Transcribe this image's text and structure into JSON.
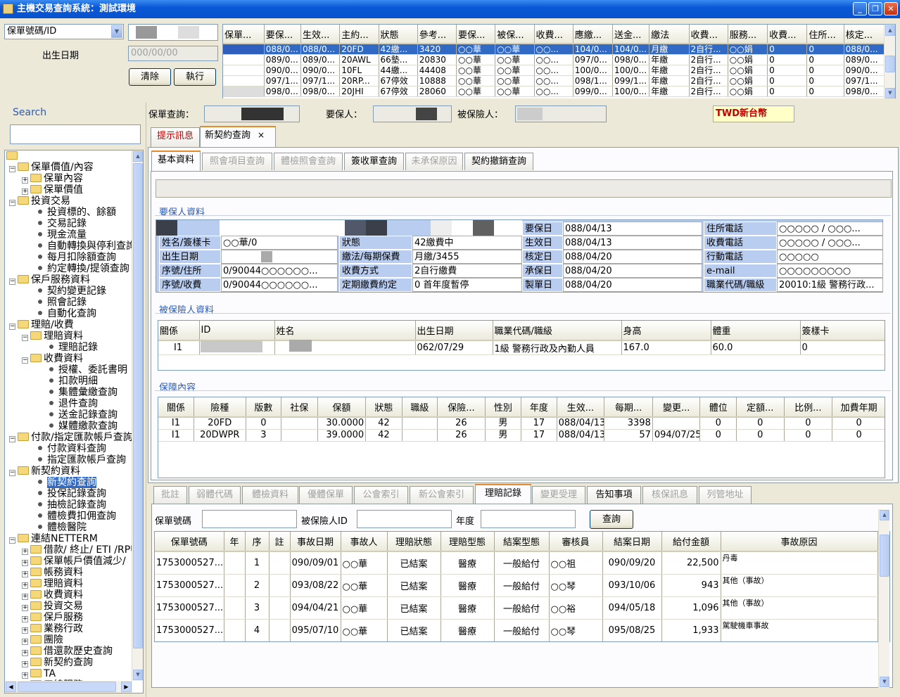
{
  "window": {
    "title": "主機交易查詢系統：測試環境",
    "btn_min": "_",
    "btn_max": "❐",
    "btn_close": "✕"
  },
  "search": {
    "field_select": "保單號碼/ID",
    "birth_label": "出生日期",
    "birth_placeholder": "000/00/00",
    "clear": "清除",
    "execute": "執行"
  },
  "topgrid": {
    "headers": [
      "保單...",
      "要保...",
      "生效...",
      "主約...",
      "狀態",
      "參考...",
      "要保...",
      "被保...",
      "收費...",
      "應繳...",
      "送金...",
      "繳法",
      "收費...",
      "服務...",
      "收費...",
      "住所...",
      "核定..."
    ],
    "rows": [
      [
        "",
        "088/0...",
        "088/0...",
        "20FD",
        "42繳...",
        "3420",
        "○○華",
        "○○華",
        "○○...",
        "104/0...",
        "104/0...",
        "月繳",
        "2自行...",
        "○○娟",
        "0",
        "0",
        "088/0..."
      ],
      [
        "",
        "089/0...",
        "089/0...",
        "20AWL",
        "66墊...",
        "20830",
        "○○華",
        "○○華",
        "○○...",
        "097/0...",
        "098/0...",
        "年繳",
        "2自行...",
        "○○娟",
        "0",
        "0",
        "089/0..."
      ],
      [
        "",
        "090/0...",
        "090/0...",
        "10FL",
        "44繳...",
        "44408",
        "○○華",
        "○○華",
        "○○...",
        "100/0...",
        "100/0...",
        "年繳",
        "2自行...",
        "○○娟",
        "0",
        "0",
        "090/0..."
      ],
      [
        "",
        "097/1...",
        "097/1...",
        "20RP...",
        "67停效",
        "10888",
        "○○華",
        "○○華",
        "○○...",
        "098/1...",
        "099/1...",
        "年繳",
        "2自行...",
        "○○娟",
        "0",
        "0",
        "097/1..."
      ],
      [
        "",
        "098/0...",
        "098/0...",
        "20JHI",
        "67停效",
        "28060",
        "○○華",
        "○○華",
        "○○...",
        "099/0...",
        "100/0...",
        "年繳",
        "2自行...",
        "○○娟",
        "0",
        "0",
        "098/0..."
      ]
    ]
  },
  "nav": {
    "search_label": "Search",
    "tree": [
      {
        "level": 1,
        "kind": "folder",
        "label": "保單價值/內容",
        "pm": "-"
      },
      {
        "level": 2,
        "kind": "folder",
        "label": "保單內容",
        "pm": "+"
      },
      {
        "level": 2,
        "kind": "folder",
        "label": "保單價值",
        "pm": "+"
      },
      {
        "level": 1,
        "kind": "folder",
        "label": "投資交易",
        "pm": "-"
      },
      {
        "level": 3,
        "kind": "leaf",
        "label": "投資標的、餘額"
      },
      {
        "level": 3,
        "kind": "leaf",
        "label": "交易記錄"
      },
      {
        "level": 3,
        "kind": "leaf",
        "label": "現金流量"
      },
      {
        "level": 3,
        "kind": "leaf",
        "label": "自動轉換與停利查詢"
      },
      {
        "level": 3,
        "kind": "leaf",
        "label": "每月扣除額查詢"
      },
      {
        "level": 3,
        "kind": "leaf",
        "label": "約定轉換/提領查詢"
      },
      {
        "level": 1,
        "kind": "folder",
        "label": "保戶服務資料",
        "pm": "-"
      },
      {
        "level": 3,
        "kind": "leaf",
        "label": "契約變更記錄"
      },
      {
        "level": 3,
        "kind": "leaf",
        "label": "照會記錄"
      },
      {
        "level": 3,
        "kind": "leaf",
        "label": "自動化查詢"
      },
      {
        "level": 1,
        "kind": "folder",
        "label": "理賠/收費",
        "pm": "-"
      },
      {
        "level": 2,
        "kind": "folder",
        "label": "理賠資料",
        "pm": "-"
      },
      {
        "level": 4,
        "kind": "leaf",
        "label": "理賠記錄"
      },
      {
        "level": 2,
        "kind": "folder",
        "label": "收費資料",
        "pm": "-"
      },
      {
        "level": 4,
        "kind": "leaf",
        "label": "授權、委託書明"
      },
      {
        "level": 4,
        "kind": "leaf",
        "label": "扣款明細"
      },
      {
        "level": 4,
        "kind": "leaf",
        "label": "集體彙繳查詢"
      },
      {
        "level": 4,
        "kind": "leaf",
        "label": "退件查詢"
      },
      {
        "level": 4,
        "kind": "leaf",
        "label": "送金記錄查詢"
      },
      {
        "level": 4,
        "kind": "leaf",
        "label": "媒體繳款查詢"
      },
      {
        "level": 1,
        "kind": "folder",
        "label": "付款/指定匯款帳戶查詢",
        "pm": "-"
      },
      {
        "level": 3,
        "kind": "leaf",
        "label": "付款資料查詢"
      },
      {
        "level": 3,
        "kind": "leaf",
        "label": "指定匯款帳戶查詢"
      },
      {
        "level": 1,
        "kind": "folder",
        "label": "新契約資料",
        "pm": "-"
      },
      {
        "level": 3,
        "kind": "leaf",
        "label": "新契約查詢",
        "selected": true
      },
      {
        "level": 3,
        "kind": "leaf",
        "label": "投保記錄查詢"
      },
      {
        "level": 3,
        "kind": "leaf",
        "label": "抽檢記錄查詢"
      },
      {
        "level": 3,
        "kind": "leaf",
        "label": "體檢費扣佣查詢"
      },
      {
        "level": 3,
        "kind": "leaf",
        "label": "體檢醫院"
      },
      {
        "level": 1,
        "kind": "folder",
        "label": "連結NETTERM",
        "pm": "-"
      },
      {
        "level": 2,
        "kind": "folder",
        "label": "借款/ 終止/ ETI /RPU",
        "pm": "+"
      },
      {
        "level": 2,
        "kind": "folder",
        "label": "保單帳戶價值減少/",
        "pm": "+"
      },
      {
        "level": 2,
        "kind": "folder",
        "label": "帳務資料",
        "pm": "+"
      },
      {
        "level": 2,
        "kind": "folder",
        "label": "理賠資料",
        "pm": "+"
      },
      {
        "level": 2,
        "kind": "folder",
        "label": "收費資料",
        "pm": "+"
      },
      {
        "level": 2,
        "kind": "folder",
        "label": "投資交易",
        "pm": "+"
      },
      {
        "level": 2,
        "kind": "folder",
        "label": "保戶服務",
        "pm": "+"
      },
      {
        "level": 2,
        "kind": "folder",
        "label": "業務行政",
        "pm": "+"
      },
      {
        "level": 2,
        "kind": "folder",
        "label": "團險",
        "pm": "+"
      },
      {
        "level": 2,
        "kind": "folder",
        "label": "借還款歷史查詢",
        "pm": "+"
      },
      {
        "level": 2,
        "kind": "folder",
        "label": "新契約查詢",
        "pm": "+"
      },
      {
        "level": 2,
        "kind": "folder",
        "label": "TA",
        "pm": "+"
      },
      {
        "level": 2,
        "kind": "folder",
        "label": "三線服務",
        "pm": "+"
      }
    ]
  },
  "header": {
    "policy_label": "保單查詢：",
    "holder_label": "要保人：",
    "insured_label": "被保險人：",
    "currency": "TWD新台幣"
  },
  "main_tabs": {
    "tab1": "提示訊息",
    "tab2": "新契約查詢",
    "close": "×"
  },
  "sub_tabs": [
    "基本資料",
    "照會項目查詢",
    "體檢照會查詢",
    "簽收單查詢",
    "未承保原因",
    "契約撤銷查詢"
  ],
  "holder": {
    "section": "要保人資料",
    "l_name": "姓名/簽樣卡",
    "v_name": "○○華/0",
    "l_birth": "出生日期",
    "v_birth": "",
    "l_addr": "序號/住所",
    "v_addr": "0/90044○○○○○○...",
    "l_fee": "序號/收費",
    "v_fee": "0/90044○○○○○○...",
    "l_status": "狀態",
    "v_status": "42繳費中",
    "l_pay": "繳法/每期保費",
    "v_pay": "月繳/3455",
    "l_method": "收費方式",
    "v_method": "2自行繳費",
    "l_regular": "定期繳費約定",
    "v_regular": "0 首年度暫停",
    "l_apply": "要保日",
    "v_apply": "088/04/13",
    "l_eff": "生效日",
    "v_eff": "088/04/13",
    "l_appr": "核定日",
    "v_appr": "088/04/20",
    "l_acc": "承保日",
    "v_acc": "088/04/20",
    "l_make": "製單日",
    "v_make": "088/04/20",
    "l_home": "住所電話",
    "v_home": "○○○○○ / ○○○...",
    "l_feephone": "收費電話",
    "v_feephone": "○○○○○ / ○○○...",
    "l_mobile": "行動電話",
    "v_mobile": "○○○○○",
    "l_email": "e-mail",
    "v_email": "○○○○○○○○○",
    "l_job": "職業代碼/職級",
    "v_job": "20010:1級 警務行政..."
  },
  "insured": {
    "section": "被保險人資料",
    "headers": [
      "關係",
      "ID",
      "姓名",
      "出生日期",
      "職業代碼/職級",
      "身高",
      "體重",
      "簽樣卡"
    ],
    "rows": [
      [
        "I1",
        "",
        "",
        "062/07/29",
        "1級 警務行政及內勤人員",
        "167.0",
        "60.0",
        "0"
      ]
    ]
  },
  "coverage": {
    "section": "保障內容",
    "headers": [
      "關係",
      "險種",
      "版數",
      "社保",
      "保額",
      "狀態",
      "職級",
      "保險...",
      "性別",
      "年度",
      "生效...",
      "每期...",
      "變更...",
      "體位",
      "定額...",
      "比例...",
      "加費年期"
    ],
    "rows": [
      [
        "I1",
        "20FD",
        "0",
        "",
        "30.0000",
        "42",
        "",
        "26",
        "男",
        "17",
        "088/04/13",
        "3398",
        "",
        "0",
        "0",
        "0",
        "0"
      ],
      [
        "I1",
        "20DWPR",
        "3",
        "",
        "39.0000",
        "42",
        "",
        "26",
        "男",
        "17",
        "088/04/13",
        "57",
        "094/07/25",
        "0",
        "0",
        "0",
        "0"
      ]
    ]
  },
  "lower_tabs": [
    "批註",
    "弱體代碼",
    "體檢資料",
    "優體保單",
    "公會索引",
    "新公會索引",
    "理賠記錄",
    "變更受理",
    "告知事項",
    "核保訊息",
    "列管地址"
  ],
  "claims": {
    "l_policy": "保單號碼",
    "l_insured": "被保險人ID",
    "l_year": "年度",
    "query": "查詢",
    "headers": [
      "保單號碼",
      "年",
      "序",
      "註",
      "事故日期",
      "事故人",
      "理賠狀態",
      "理賠型態",
      "結案型態",
      "審核員",
      "結案日期",
      "給付金額",
      "事故原因"
    ],
    "rows": [
      [
        "1753000527...",
        "",
        "1",
        "",
        "090/09/01",
        "○○華",
        "已結案",
        "醫療",
        "一般給付",
        "○○祖",
        "090/09/20",
        "22,500",
        "丹毒"
      ],
      [
        "1753000527...",
        "",
        "2",
        "",
        "093/08/22",
        "○○華",
        "已結案",
        "醫療",
        "一般給付",
        "○○琴",
        "093/10/06",
        "943",
        "其他（事故）"
      ],
      [
        "1753000527...",
        "",
        "3",
        "",
        "094/04/21",
        "○○華",
        "已結案",
        "醫療",
        "一般給付",
        "○○裕",
        "094/05/18",
        "1,096",
        "其他（事故）"
      ],
      [
        "1753000527...",
        "",
        "4",
        "",
        "095/07/10",
        "○○華",
        "已結案",
        "醫療",
        "一般給付",
        "○○琴",
        "095/08/25",
        "1,933",
        "駕駛機車事故"
      ]
    ]
  }
}
